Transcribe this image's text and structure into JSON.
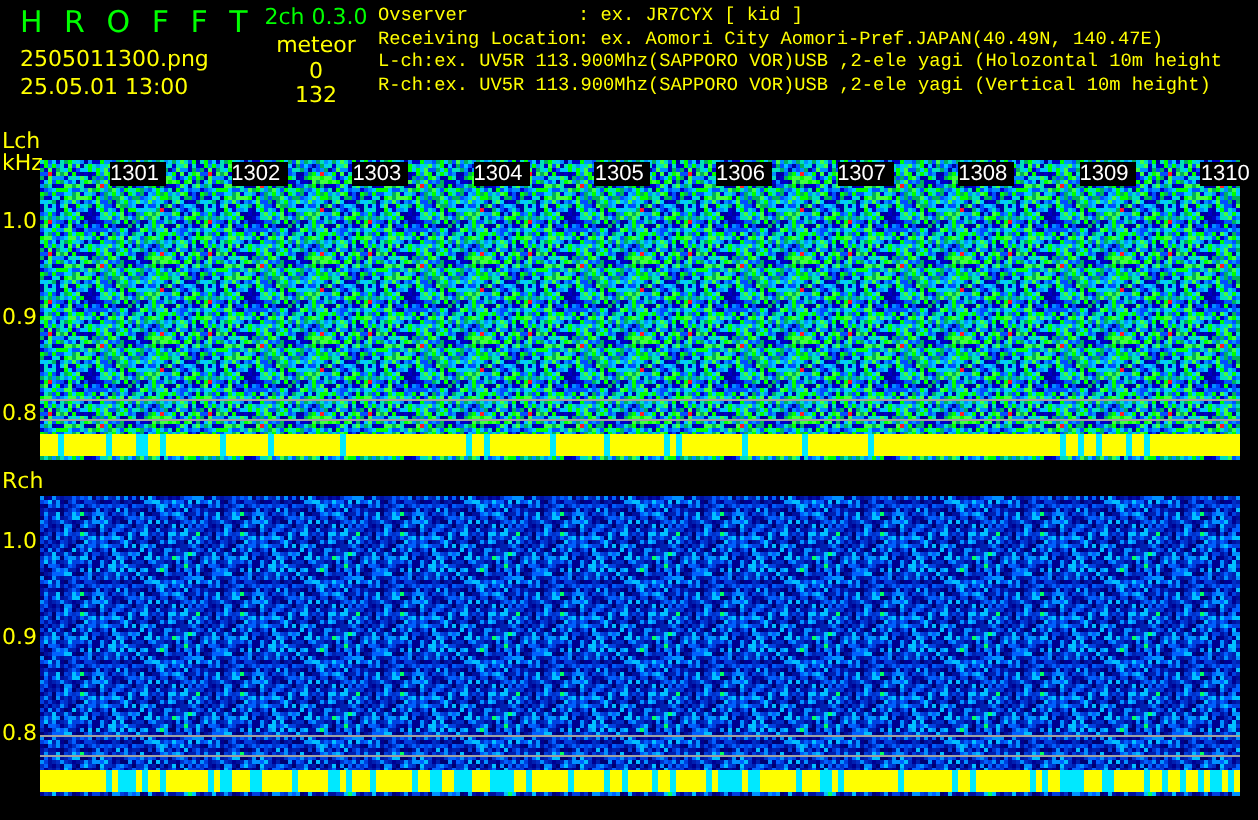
{
  "header": {
    "title": "H R O F F T",
    "version": "2ch 0.3.0",
    "filename": "2505011300.png",
    "datetime": "25.05.01 13:00",
    "counter_label": "meteor",
    "counts": [
      "0",
      "132"
    ]
  },
  "info": [
    {
      "label": "Ovserver",
      "value": ": ex. JR7CYX [ kid ]"
    },
    {
      "label": "Receiving Location",
      "value": ": ex. Aomori City Aomori-Pref.JAPAN(40.49N, 140.47E)"
    }
  ],
  "channel_lines": [
    "L-ch:ex. UV5R 113.900Mhz(SAPPORO VOR)USB ,2-ele yagi (Holozontal 10m height",
    "R-ch:ex. UV5R 113.900Mhz(SAPPORO VOR)USB ,2-ele yagi (Vertical 10m height)"
  ],
  "channels": [
    {
      "kind": "left",
      "label": "Lch",
      "unit": "kHz",
      "time_labels": [
        "1301",
        "1302",
        "1303",
        "1304",
        "1305",
        "1306",
        "1307",
        "1308",
        "1309",
        "1310"
      ],
      "y_ticks": [
        "1.0",
        "0.9",
        "0.8"
      ]
    },
    {
      "kind": "right",
      "label": "Rch",
      "y_ticks": [
        "1.0",
        "0.9",
        "0.8"
      ]
    }
  ]
}
